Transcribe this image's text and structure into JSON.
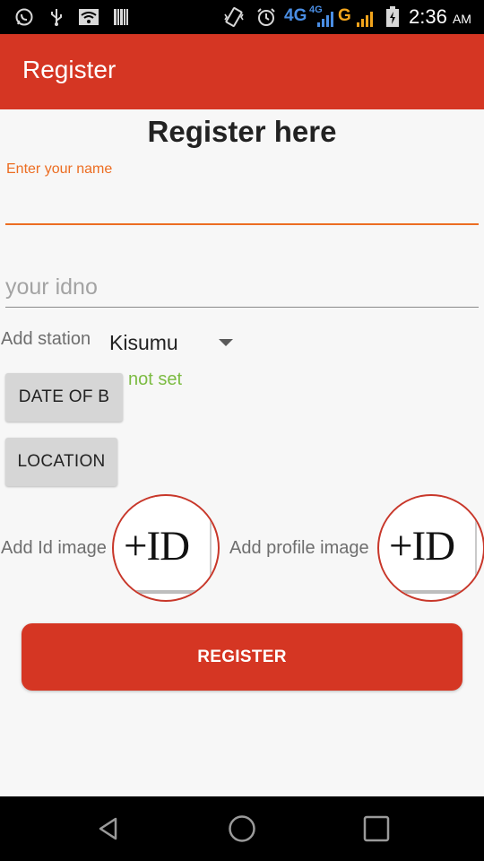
{
  "status_bar": {
    "network_4g": "4G",
    "network_4g_small": "4G",
    "network_g": "G",
    "time": "2:36",
    "ampm": "AM",
    "icons": [
      "whatsapp-icon",
      "usb-icon",
      "wifi-icon",
      "barcode-icon",
      "vibrate-icon",
      "alarm-icon",
      "signal-icon",
      "battery-charging-icon"
    ]
  },
  "toolbar": {
    "title": "Register"
  },
  "form": {
    "heading": "Register here",
    "name_label": "Enter your name",
    "name_value": "",
    "idno_placeholder": "your idno",
    "station_label": "Add station",
    "station_value": "Kisumu",
    "dob_button": "DATE OF B",
    "dob_value": "not set",
    "location_button": "LOCATION",
    "id_image_label": "Add Id image",
    "profile_image_label": "Add profile image",
    "id_placeholder_text": "+ID",
    "profile_placeholder_text": "+ID",
    "register_button": "REGISTER"
  },
  "colors": {
    "primary": "#d53623",
    "accent": "#ec6d22",
    "not_set": "#7cbb42",
    "network_blue": "#4a8ee4",
    "network_orange": "#f2a41c"
  },
  "nav_bar": {
    "icons": [
      "back-icon",
      "home-icon",
      "recents-icon"
    ]
  }
}
